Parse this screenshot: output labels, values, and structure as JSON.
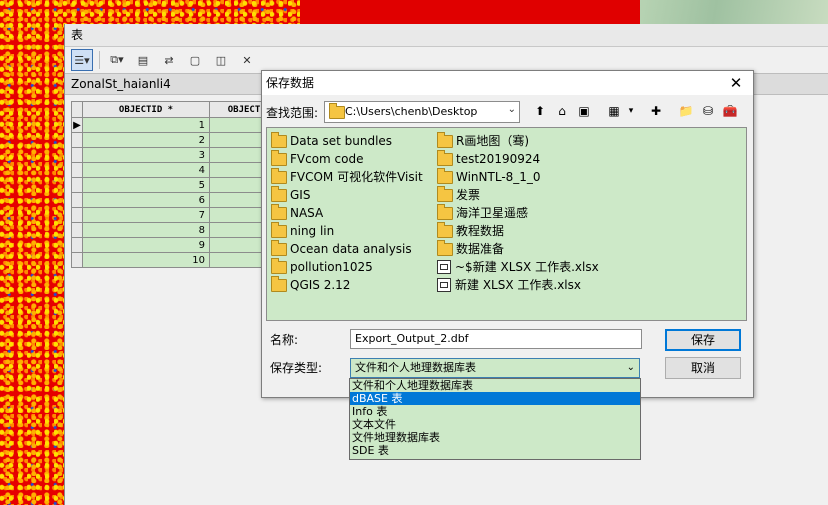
{
  "table_window": {
    "title": "表",
    "tab": "ZonalSt_haianli4",
    "columns": [
      "OBJECTID *",
      "OBJECT"
    ],
    "rows": [
      "1",
      "2",
      "3",
      "4",
      "5",
      "6",
      "7",
      "8",
      "9",
      "10"
    ],
    "current_row_marker": "▶"
  },
  "dialog": {
    "title": "保存数据",
    "close_glyph": "✕",
    "look_in_label": "查找范围:",
    "look_in_path": "C:\\Users\\chenb\\Desktop",
    "files_left": [
      "Data set bundles",
      "FVcom code",
      "FVCOM 可视化软件Visit",
      "GIS",
      "NASA",
      "ning lin",
      "Ocean data analysis",
      "pollution1025",
      "QGIS 2.12"
    ],
    "files_right": [
      {
        "name": "R画地图（骞)",
        "kind": "folder"
      },
      {
        "name": "test20190924",
        "kind": "folder"
      },
      {
        "name": "WinNTL-8_1_0",
        "kind": "folder"
      },
      {
        "name": "发票",
        "kind": "folder"
      },
      {
        "name": "海洋卫星遥感",
        "kind": "folder"
      },
      {
        "name": "教程数据",
        "kind": "folder"
      },
      {
        "name": "数据准备",
        "kind": "folder"
      },
      {
        "name": "~$新建 XLSX 工作表.xlsx",
        "kind": "table"
      },
      {
        "name": "新建 XLSX 工作表.xlsx",
        "kind": "table"
      }
    ],
    "name_label": "名称:",
    "name_value": "Export_Output_2.dbf",
    "type_label": "保存类型:",
    "type_value": "文件和个人地理数据库表",
    "save_button": "保存",
    "cancel_button": "取消",
    "type_options": [
      "文件和个人地理数据库表",
      "dBASE 表",
      "Info 表",
      "文本文件",
      "文件地理数据库表",
      "SDE 表"
    ],
    "type_highlighted_index": 1
  },
  "colors": {
    "list_bg": "#cde9c8",
    "highlight": "#0078d7",
    "map_red": "#e60000"
  }
}
